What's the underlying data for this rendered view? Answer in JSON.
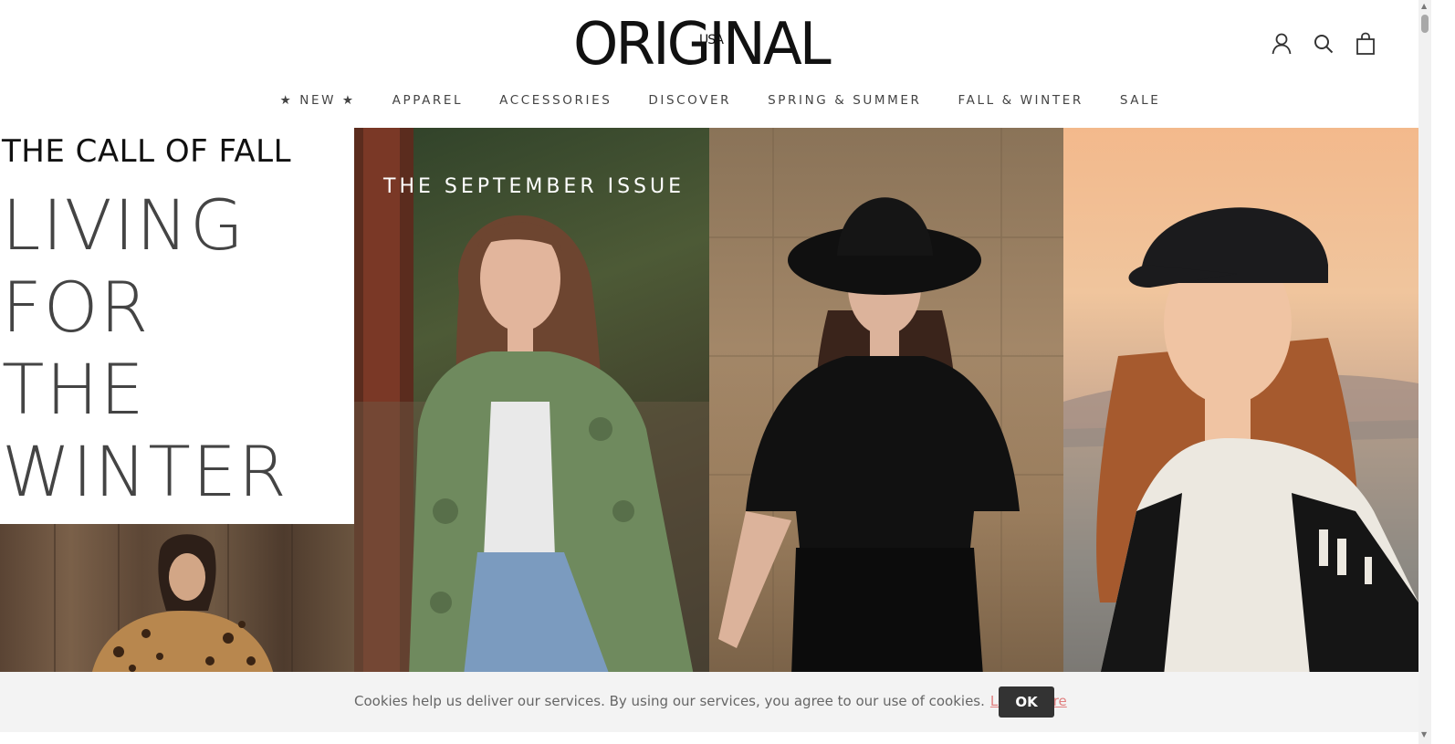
{
  "brand": {
    "logo_text": "ORIGINAL",
    "logo_sub": "USA"
  },
  "header_icons": {
    "account": "account-icon",
    "search": "search-icon",
    "cart": "shopping-bag-icon"
  },
  "nav": {
    "items": [
      "★ NEW ★",
      "APPAREL",
      "ACCESSORIES",
      "DISCOVER",
      "SPRING & SUMMER",
      "FALL & WINTER",
      "SALE"
    ]
  },
  "hero": {
    "kicker": "THE CALL OF FALL",
    "headline_lines": [
      "LIVING",
      "FOR",
      "THE",
      "WINTER"
    ],
    "september": "THE SEPTEMBER ISSUE"
  },
  "cookie": {
    "message": "Cookies help us deliver our services. By using our services, you agree to our use of cookies.",
    "link": "Learn More",
    "ok": "OK"
  },
  "colors": {
    "link": "#e07f7f",
    "ok_bg": "#333333",
    "cookie_bg": "#f3f3f3"
  }
}
